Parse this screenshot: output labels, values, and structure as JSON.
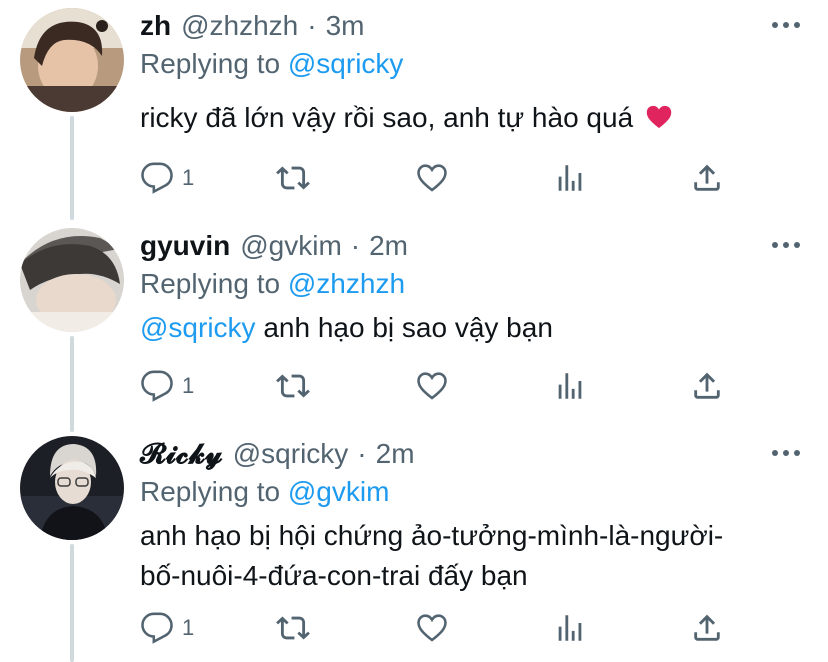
{
  "tweets": [
    {
      "name": "zh",
      "handle": "@zhzhzh",
      "separator": "·",
      "time": "3m",
      "replying_prefix": "Replying to",
      "replying_to": "@sqricky",
      "text": "ricky đã lớn vậy rồi sao, anh tự hào quá",
      "emoji": "red-heart-emoji",
      "reply_count": "1"
    },
    {
      "name": "gyuvin",
      "handle": "@gvkim",
      "separator": "·",
      "time": "2m",
      "replying_prefix": "Replying to",
      "replying_to": "@zhzhzh",
      "text_mention": "@sqricky",
      "text": "anh hạo bị sao vậy bạn",
      "reply_count": "1"
    },
    {
      "name": "𝓡𝓲𝓬𝓴𝔂",
      "handle": "@sqricky",
      "separator": "·",
      "time": "2m",
      "replying_prefix": "Replying to",
      "replying_to": "@gvkim",
      "text_line1": "anh hạo bị hội chứng ảo-tưởng-mình-là-người-",
      "text_line2": "bố-nuôi-4-đứa-con-trai đấy bạn",
      "reply_count": "1"
    }
  ],
  "icons": {
    "reply": "reply-icon",
    "retweet": "retweet-icon",
    "like": "like-icon",
    "analytics": "analytics-icon",
    "share": "share-icon",
    "more": "more-icon"
  },
  "colors": {
    "text": "#0f1419",
    "secondary": "#536471",
    "link": "#1d9bf0",
    "thread_line": "#cfd9de",
    "heart": "#e0245e"
  }
}
